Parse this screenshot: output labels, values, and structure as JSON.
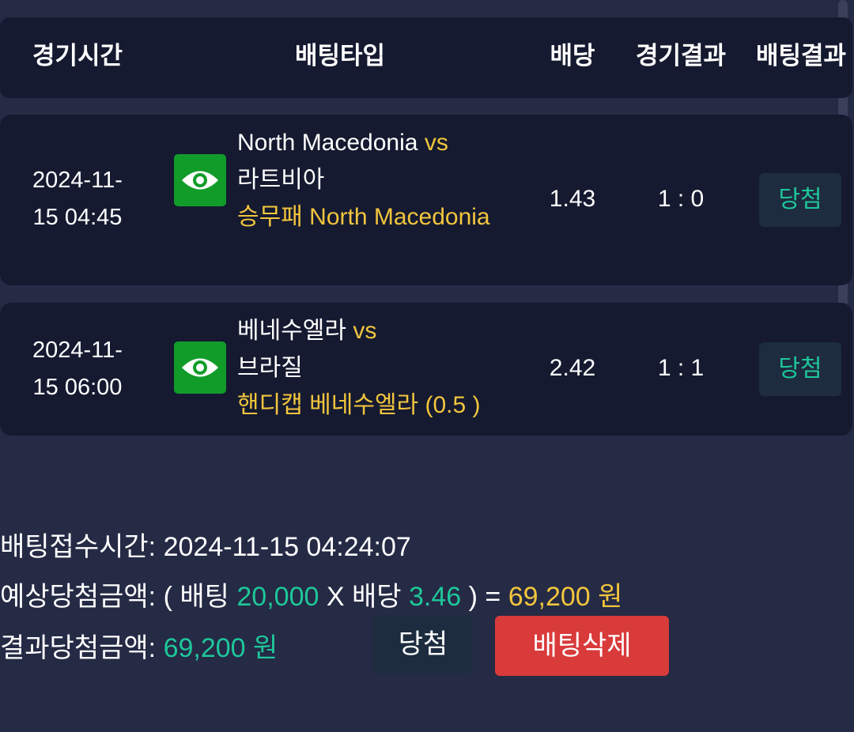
{
  "header": {
    "time": "경기시간",
    "bet_type": "배팅타입",
    "odds": "배당",
    "match_result": "경기결과",
    "bet_result": "배팅결과"
  },
  "matches": [
    {
      "time_line1": "2024-11-",
      "time_line2": "15 04:45",
      "icon": "eye-icon",
      "team1": "North Macedonia",
      "vs": "vs",
      "team2": "라트비아",
      "bet_type": "승무패",
      "bet_pick": "North Macedonia",
      "odds": "1.43",
      "score": "1 : 0",
      "result": "당첨"
    },
    {
      "time_line1": "2024-11-",
      "time_line2": "15 06:00",
      "icon": "eye-icon",
      "team1": "베네수엘라",
      "vs": "vs",
      "team2": "브라질",
      "bet_type": "핸디캡",
      "bet_pick": "베네수엘라 (0.5 )",
      "odds": "2.42",
      "score": "1 : 1",
      "result": "당첨"
    }
  ],
  "summary": {
    "accept_time_label": "배팅접수시간:",
    "accept_time_value": "2024-11-15 04:24:07",
    "expected_label": "예상당첨금액:",
    "expected_open": "( 배팅",
    "bet_amount": "20,000",
    "times": "X 배당",
    "total_odds": "3.46",
    "close_eq": ") =",
    "expected_amount": "69,200 원",
    "result_label": "결과당첨금액:",
    "result_amount": "69,200 원"
  },
  "buttons": {
    "win": "당첨",
    "delete": "배팅삭제"
  },
  "colors": {
    "background": "#252a45",
    "card": "#151a30",
    "yellow": "#f2c53d",
    "green": "#1ec79a",
    "eye_icon_bg": "#119c2a",
    "delete_button": "#d93a3a"
  }
}
